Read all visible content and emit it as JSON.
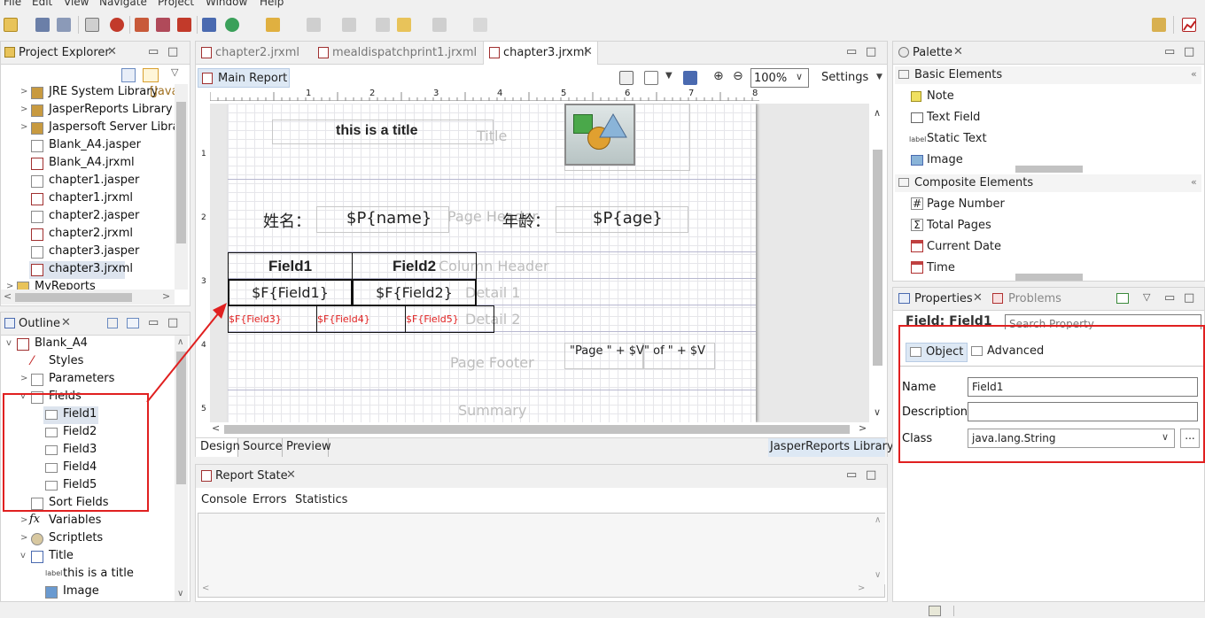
{
  "menu": [
    "File",
    "Edit",
    "View",
    "Navigate",
    "Project",
    "Window",
    "Help"
  ],
  "project_explorer": {
    "title": "Project Explorer",
    "items": [
      {
        "label": "JRE System Library",
        "suffix": "[Java"
      },
      {
        "label": "JasperReports Library",
        "suffix": ""
      },
      {
        "label": "Jaspersoft Server Library",
        "suffix": ""
      },
      {
        "label": "Blank_A4.jasper",
        "suffix": ""
      },
      {
        "label": "Blank_A4.jrxml",
        "suffix": ""
      },
      {
        "label": "chapter1.jasper",
        "suffix": ""
      },
      {
        "label": "chapter1.jrxml",
        "suffix": ""
      },
      {
        "label": "chapter2.jasper",
        "suffix": ""
      },
      {
        "label": "chapter2.jrxml",
        "suffix": ""
      },
      {
        "label": "chapter3.jasper",
        "suffix": ""
      },
      {
        "label": "chapter3.jrxml",
        "suffix": ""
      },
      {
        "label": "MyReports",
        "suffix": ""
      }
    ]
  },
  "outline": {
    "title": "Outline",
    "items": [
      "Blank_A4",
      "Styles",
      "Parameters",
      "Fields",
      "Field1",
      "Field2",
      "Field3",
      "Field4",
      "Field5",
      "Sort Fields",
      "Variables",
      "Scriptlets",
      "Title",
      "this is a title",
      "Image"
    ]
  },
  "editor": {
    "tabs": [
      "chapter2.jrxml",
      "mealdispatchprint1.jrxml",
      "chapter3.jrxml"
    ],
    "main_report": "Main Report",
    "zoom": "100%",
    "settings": "Settings",
    "ruler": [
      "1",
      "2",
      "3",
      "4",
      "5",
      "6",
      "7",
      "8"
    ],
    "vruler": [
      "1",
      "2",
      "3",
      "4",
      "5"
    ],
    "bands": [
      "Title",
      "Page Header",
      "Column Header",
      "Detail 1",
      "Detail 2",
      "Page Footer",
      "Summary"
    ],
    "title_text": "this is a title",
    "name_label": "姓名：",
    "name_field": "$P{name}",
    "age_label": "年龄：",
    "age_field": "$P{age}",
    "col_headers": [
      "Field1",
      "Field2"
    ],
    "detail1": [
      "$F{Field1}",
      "$F{Field2}"
    ],
    "detail2": [
      "$F{Field3}",
      "$F{Field4}",
      "$F{Field5}"
    ],
    "footer_expr_1": "\"Page \" + $V",
    "footer_expr_2": "\" of \" + $V",
    "bottom_tabs": [
      "Design",
      "Source",
      "Preview"
    ],
    "library": "JasperReports Library"
  },
  "report_state": {
    "title": "Report State",
    "tabs": [
      "Console",
      "Errors",
      "Statistics"
    ]
  },
  "palette": {
    "title": "Palette",
    "basic": "Basic Elements",
    "basic_items": [
      "Note",
      "Text Field",
      "Static Text",
      "Image"
    ],
    "composite": "Composite Elements",
    "composite_items": [
      "Page Number",
      "Total Pages",
      "Current Date",
      "Time"
    ]
  },
  "properties": {
    "title": "Properties",
    "problems": "Problems",
    "heading": "Field: Field1",
    "search_placeholder": "Search Property",
    "tabs": [
      "Object",
      "Advanced"
    ],
    "name_label": "Name",
    "name_value": "Field1",
    "description_label": "Description",
    "description_value": "",
    "class_label": "Class",
    "class_value": "java.lang.String",
    "ellipsis": "..."
  },
  "accent_red": "#e02020"
}
